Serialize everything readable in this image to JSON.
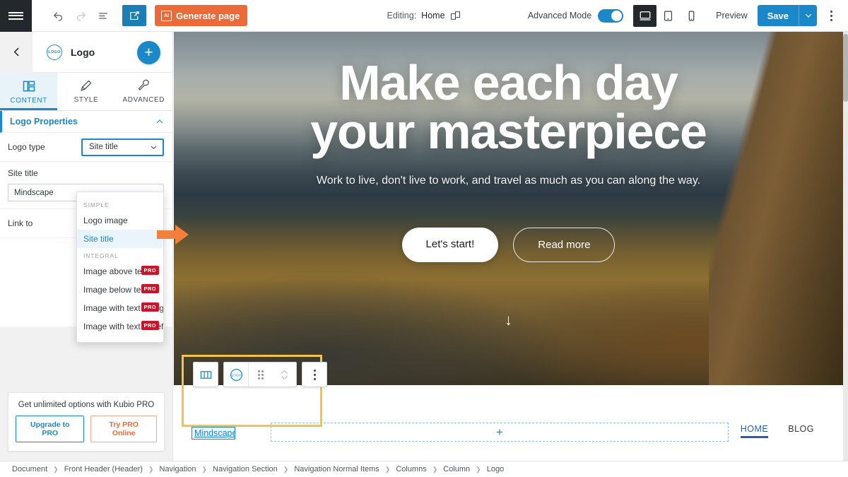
{
  "topbar": {
    "menu_icon": "hamburger-icon",
    "undo_label": "Undo",
    "redo_label": "Redo",
    "outline_label": "Document outline",
    "editor_label": "Edit",
    "generate_label": "Generate page",
    "generate_icon_text": "AI",
    "editing_prefix": "Editing:",
    "editing_page": "Home",
    "advanced_mode_label": "Advanced Mode",
    "advanced_mode_on": true,
    "device_desktop": "Desktop",
    "device_tablet": "Tablet",
    "device_mobile": "Mobile",
    "preview_label": "Preview",
    "save_label": "Save",
    "accent_blue": "#1b88c9",
    "accent_orange": "#ec6a37"
  },
  "panel": {
    "back_label": "Back",
    "logo_chip_text": "LOGO",
    "title": "Logo",
    "add_label": "+",
    "tabs": [
      {
        "label": "CONTENT",
        "icon": "layout-icon",
        "active": true
      },
      {
        "label": "STYLE",
        "icon": "brush-icon",
        "active": false
      },
      {
        "label": "ADVANCED",
        "icon": "wrench-icon",
        "active": false
      }
    ],
    "section_title": "Logo Properties",
    "fields": {
      "logo_type_label": "Logo type",
      "logo_type_value": "Site title",
      "site_title_label": "Site title",
      "site_title_value": "Mindscape",
      "site_title_placeholder": "Site title",
      "link_to_label": "Link to"
    },
    "dropdown": {
      "group_simple": "SIMPLE",
      "group_integral": "INTEGRAL",
      "items": [
        {
          "label": "Logo image",
          "pro": false,
          "selected": false
        },
        {
          "label": "Site title",
          "pro": false,
          "selected": true
        },
        {
          "label": "Image above text",
          "pro": true,
          "selected": false
        },
        {
          "label": "Image below text",
          "pro": true,
          "selected": false
        },
        {
          "label": "Image with text on right",
          "pro": true,
          "selected": false
        },
        {
          "label": "Image with text on left",
          "pro": true,
          "selected": false
        }
      ],
      "pro_badge": "PRO"
    },
    "promo": {
      "text": "Get unlimited options with Kubio PRO",
      "primary_btn": "Upgrade to PRO",
      "secondary_btn": "Try PRO Online"
    }
  },
  "canvas": {
    "hero": {
      "heading_line1": "Make each day",
      "heading_line2": "your masterpiece",
      "subtitle": "Work to live, don't live to work, and travel as much as you can along the way.",
      "primary_btn": "Let's start!",
      "secondary_btn": "Read more",
      "scroll_arrow": "↓"
    },
    "header": {
      "site_title": "Mindscape",
      "add_block": "+",
      "nav": [
        {
          "label": "HOME",
          "active": true
        },
        {
          "label": "BLOG",
          "active": false
        }
      ],
      "toolbar": {
        "columns_icon": "columns-icon",
        "logo_icon": "logo-icon",
        "drag_icon": "drag-handle-icon",
        "move_icon": "move-updown-icon",
        "more_icon": "more-options-icon"
      }
    }
  },
  "breadcrumb": {
    "items": [
      "Document",
      "Front Header (Header)",
      "Navigation",
      "Navigation Section",
      "Navigation Normal Items",
      "Columns",
      "Column",
      "Logo"
    ],
    "separator": "❯"
  }
}
